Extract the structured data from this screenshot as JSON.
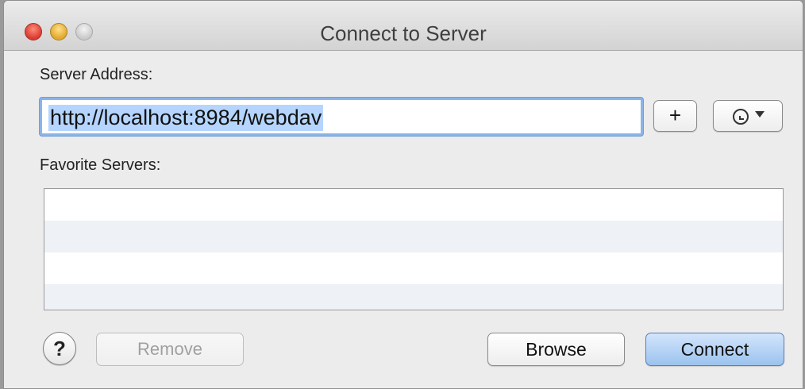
{
  "window": {
    "title": "Connect to Server",
    "traffic_lights": [
      "close",
      "minimize",
      "zoom"
    ]
  },
  "server_address": {
    "label": "Server Address:",
    "value": "http://localhost:8984/webdav",
    "add_button_label": "+",
    "recent_servers_icon": "clock-icon",
    "recent_servers_caret_icon": "chevron-down-icon"
  },
  "favorites": {
    "label": "Favorite Servers:",
    "items": []
  },
  "footer": {
    "help_label": "?",
    "remove_label": "Remove",
    "browse_label": "Browse",
    "connect_label": "Connect"
  },
  "colors": {
    "default_button": "#9bc3ef",
    "selection": "#b5d5ff",
    "focus_ring": "#8ab4e8"
  }
}
